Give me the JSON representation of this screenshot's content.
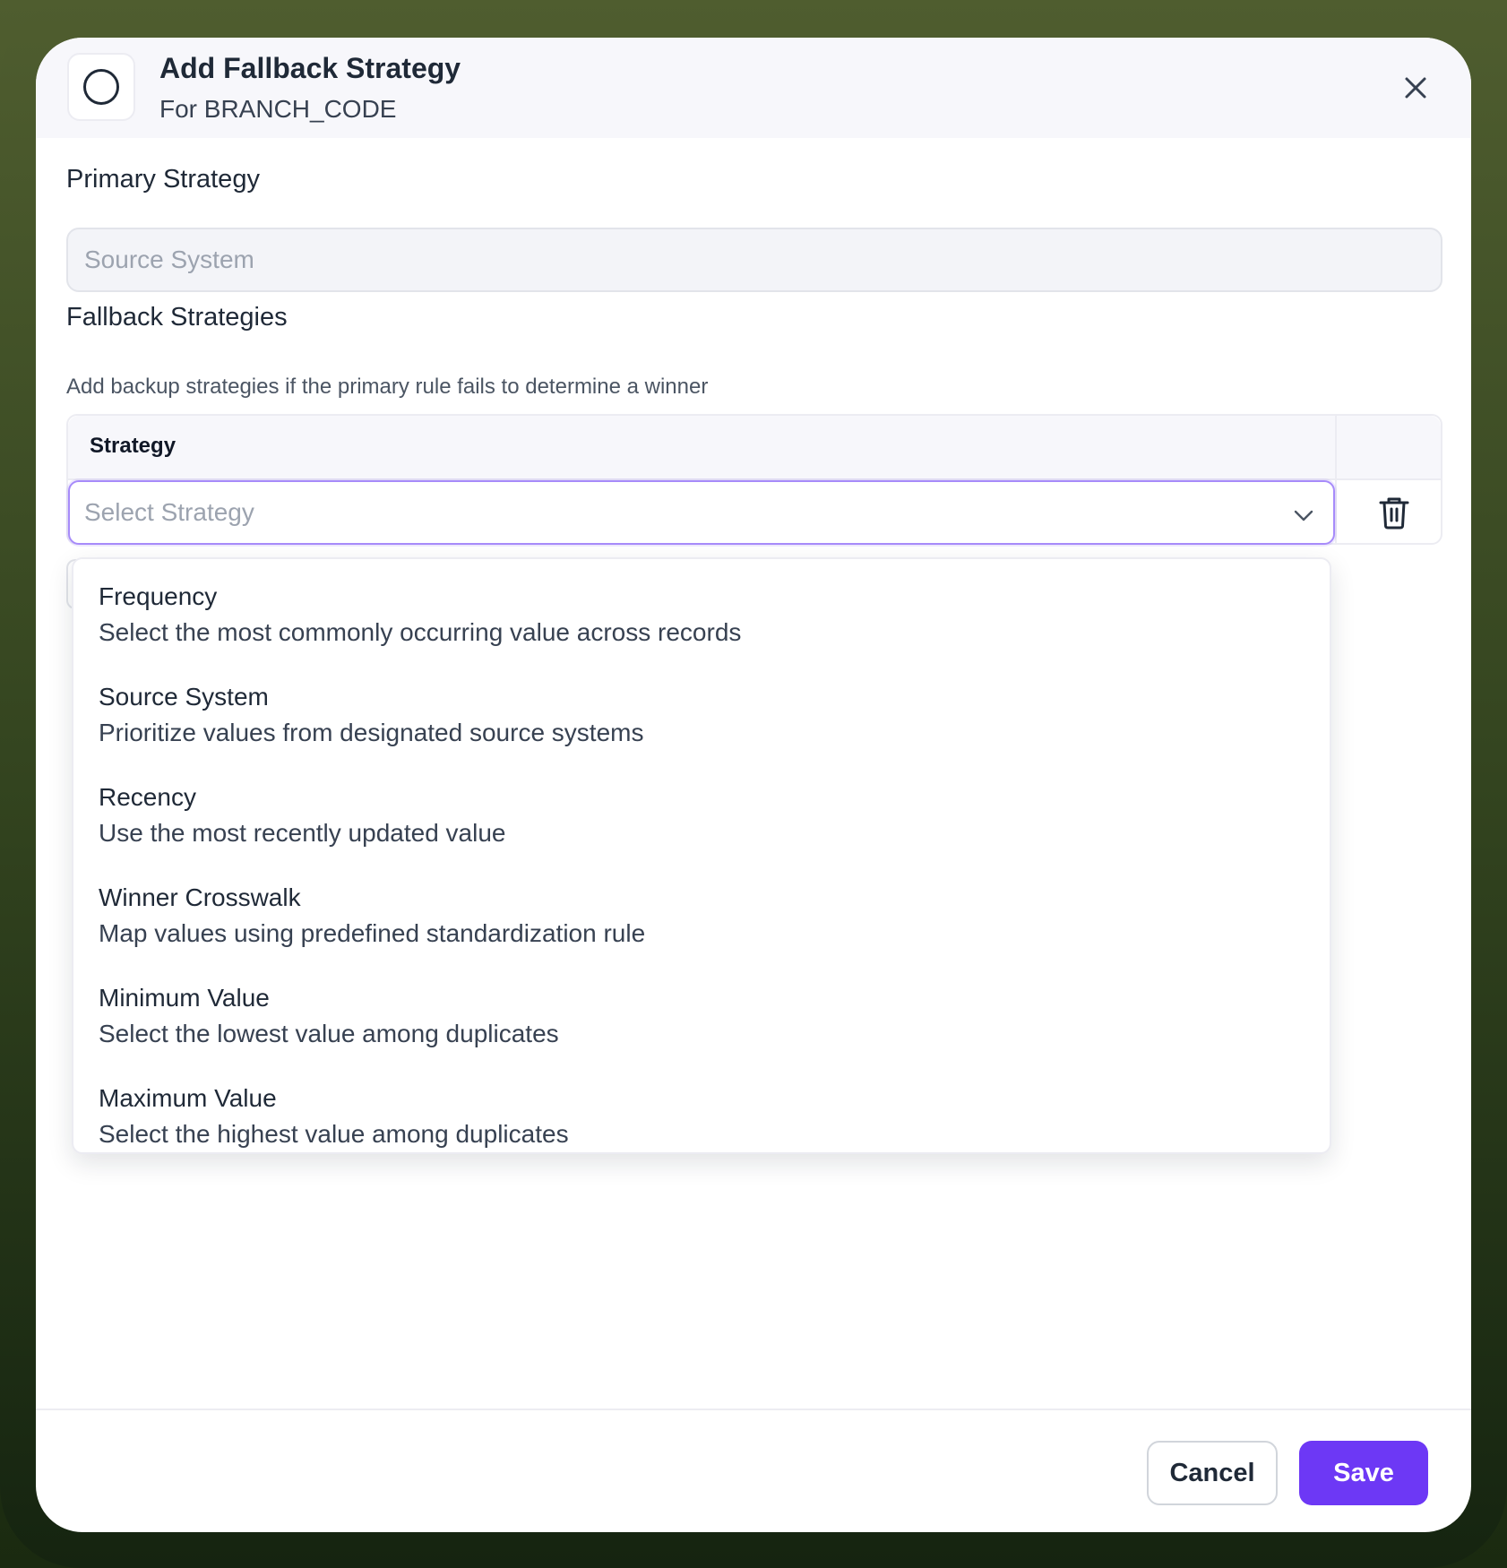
{
  "dialog": {
    "title": "Add Fallback Strategy",
    "subtitle": "For BRANCH_CODE",
    "header_icon": "circle-icon",
    "close_icon": "close-icon"
  },
  "primary": {
    "label": "Primary Strategy",
    "placeholder": "Source System"
  },
  "fallback": {
    "label": "Fallback Strategies",
    "helper": "Add backup strategies if the primary rule fails to determine a winner",
    "table": {
      "column_strategy": "Strategy"
    },
    "select": {
      "placeholder": "Select Strategy",
      "icon": "chevron-down-icon"
    },
    "delete_icon": "trash-icon"
  },
  "options": [
    {
      "title": "Frequency",
      "description": "Select the most commonly occurring value across records"
    },
    {
      "title": "Source System",
      "description": "Prioritize values from designated source systems"
    },
    {
      "title": "Recency",
      "description": "Use the most recently updated value"
    },
    {
      "title": "Winner Crosswalk",
      "description": "Map values using predefined standardization rule"
    },
    {
      "title": "Minimum Value",
      "description": "Select the lowest value among duplicates"
    },
    {
      "title": "Maximum Value",
      "description": "Select the highest value among duplicates"
    }
  ],
  "footer": {
    "cancel_label": "Cancel",
    "save_label": "Save"
  },
  "colors": {
    "accent": "#6d38f5",
    "focus_border": "#a78bfa",
    "header_bg": "#f7f7fb",
    "frame_bg": "#3a4a22"
  }
}
